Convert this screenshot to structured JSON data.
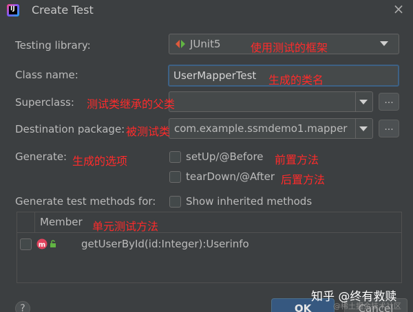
{
  "window": {
    "title": "Create Test",
    "close_icon": "×"
  },
  "form": {
    "testing_library_label": "Testing library:",
    "testing_library_value": "JUnit5",
    "class_name_label": "Class name:",
    "class_name_value": "UserMapperTest",
    "superclass_label": "Superclass:",
    "superclass_value": "",
    "destination_label": "Destination package:",
    "destination_value": "com.example.ssmdemo1.mapper",
    "generate_label": "Generate:",
    "setup_label": "setUp/@Before",
    "setup_checked": false,
    "teardown_label": "tearDown/@After",
    "teardown_checked": false,
    "generate_methods_label": "Generate test methods for:",
    "show_inherited_label": "Show inherited methods",
    "show_inherited_checked": false,
    "dots_label": "..."
  },
  "table": {
    "header": "Member",
    "rows": [
      {
        "checked": false,
        "method": "getUserById(id:Integer):Userinfo"
      }
    ]
  },
  "annotations": {
    "testing_library": "使用测试的框架",
    "class_name": "生成的类名",
    "superclass": "测试类继承的父类",
    "destination": "被测试类",
    "generate": "生成的选项",
    "setup": "前置方法",
    "teardown": "后置方法",
    "member": "单元测试方法"
  },
  "buttons": {
    "help": "?",
    "ok": "OK",
    "cancel": "Cancel"
  },
  "watermark": {
    "main": "知乎 @终有救赎",
    "sub": "@稀土掘金技术社区"
  },
  "colors": {
    "background": "#3c3f41",
    "annotation": "#ff2b2b",
    "focus_border": "#3d6185",
    "ok_button": "#365880"
  }
}
